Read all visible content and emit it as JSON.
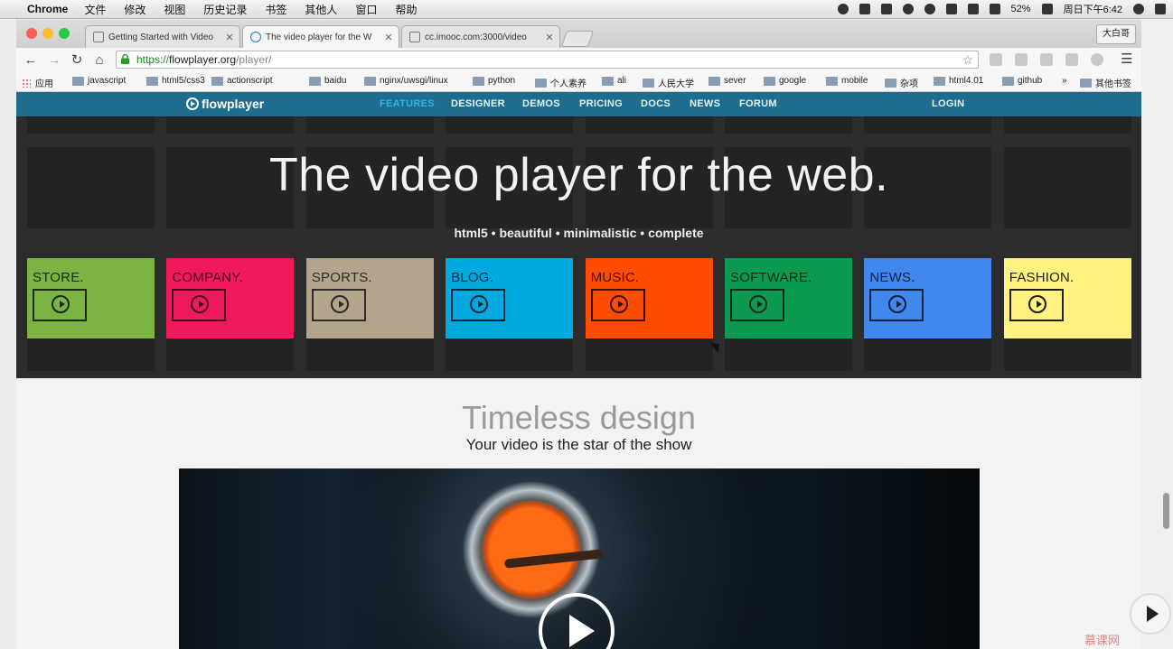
{
  "menubar": {
    "app": "Chrome",
    "items": [
      "文件",
      "修改",
      "视图",
      "历史记录",
      "书签",
      "其他人",
      "窗口",
      "帮助"
    ],
    "battery": "52%",
    "clock": "周日下午6:42"
  },
  "tabs": [
    {
      "title": "Getting Started with Video",
      "active": false
    },
    {
      "title": "The video player for the W",
      "active": true
    },
    {
      "title": "cc.imooc.com:3000/video",
      "active": false
    }
  ],
  "profile": "大白哥",
  "omnibox": {
    "scheme": "https://",
    "host": "flowplayer.org",
    "path": "/player/"
  },
  "bookmarks": [
    "应用",
    "javascript",
    "html5/css3",
    "actionscript",
    "baidu",
    "nginx/uwsgi/linux",
    "python",
    "个人素养",
    "ali",
    "人民大学",
    "sever",
    "google",
    "mobile",
    "杂项",
    "html4.01",
    "github",
    "»",
    "其他书签"
  ],
  "site": {
    "logo": "flowplayer",
    "nav": [
      "FEATURES",
      "DESIGNER",
      "DEMOS",
      "PRICING",
      "DOCS",
      "NEWS",
      "FORUM"
    ],
    "active_nav": "FEATURES",
    "login": "LOGIN"
  },
  "hero": {
    "title": "The video player for the web.",
    "tagline": "html5 • beautiful • minimalistic • complete"
  },
  "categories": [
    {
      "label": "STORE.",
      "bg": "#7cb342",
      "fg": "#1b2a10"
    },
    {
      "label": "COMPANY.",
      "bg": "#f0195c",
      "fg": "#4a0820"
    },
    {
      "label": "SPORTS.",
      "bg": "#b3a58c",
      "fg": "#2c2a26"
    },
    {
      "label": "BLOG.",
      "bg": "#00aadf",
      "fg": "#06283a"
    },
    {
      "label": "MUSIC.",
      "bg": "#ff4c00",
      "fg": "#3a1200"
    },
    {
      "label": "SOFTWARE.",
      "bg": "#0b9a50",
      "fg": "#062d17"
    },
    {
      "label": "NEWS.",
      "bg": "#4087ee",
      "fg": "#0e1f3d"
    },
    {
      "label": "FASHION.",
      "bg": "#fff27e",
      "fg": "#1f1d10"
    }
  ],
  "section": {
    "title": "Timeless design",
    "subtitle": "Your video is the star of the show"
  },
  "watermark": "慕课网"
}
